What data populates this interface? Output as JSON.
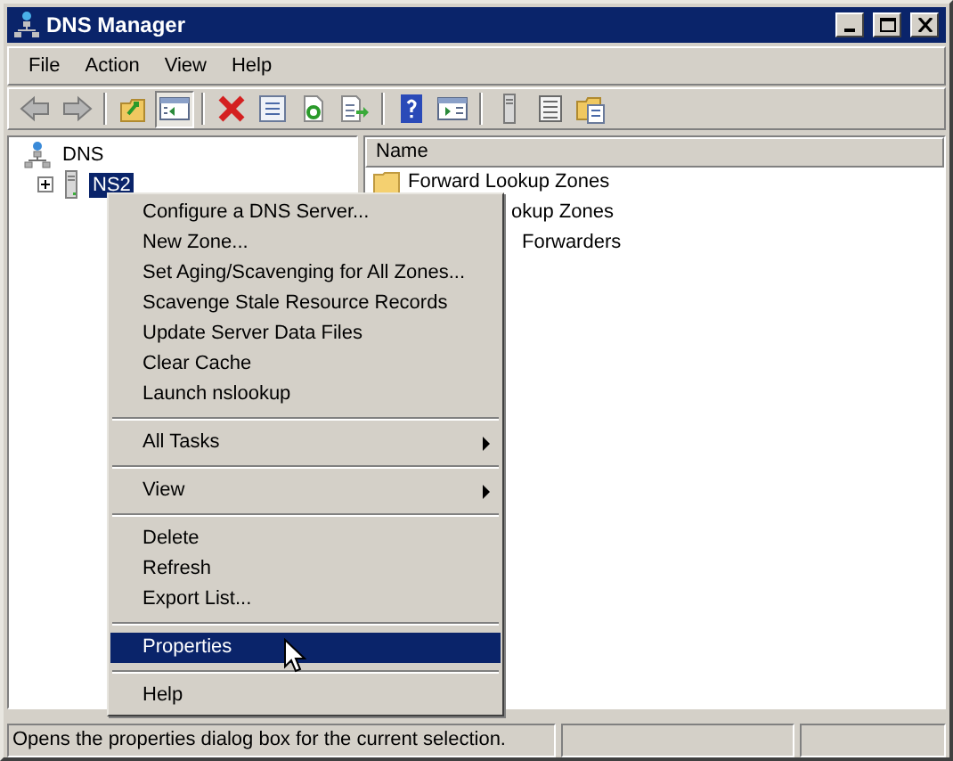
{
  "window": {
    "title": "DNS Manager"
  },
  "menu_bar": [
    "File",
    "Action",
    "View",
    "Help"
  ],
  "toolbar": [
    {
      "kind": "back",
      "pressed": false
    },
    {
      "kind": "forward",
      "pressed": false
    },
    {
      "kind": "sep"
    },
    {
      "kind": "up",
      "pressed": false
    },
    {
      "kind": "tree",
      "pressed": true
    },
    {
      "kind": "sep"
    },
    {
      "kind": "delete",
      "pressed": false
    },
    {
      "kind": "properties",
      "pressed": false
    },
    {
      "kind": "refresh",
      "pressed": false
    },
    {
      "kind": "export",
      "pressed": false
    },
    {
      "kind": "sep"
    },
    {
      "kind": "help",
      "pressed": false
    },
    {
      "kind": "action",
      "pressed": false
    },
    {
      "kind": "sep"
    },
    {
      "kind": "server",
      "pressed": false
    },
    {
      "kind": "list",
      "pressed": false
    },
    {
      "kind": "folders",
      "pressed": false
    }
  ],
  "tree": [
    {
      "label": "DNS",
      "kind": "root",
      "selected": false,
      "children": [
        {
          "label": "NS2",
          "kind": "server",
          "expanded": false,
          "selected": true
        }
      ]
    }
  ],
  "list": {
    "columns": [
      "Name"
    ],
    "rows": [
      {
        "label": "Forward Lookup Zones",
        "icon": true
      },
      {
        "label": "okup Zones",
        "icon": false
      },
      {
        "label": "Forwarders",
        "icon": false
      }
    ]
  },
  "context_menu": [
    {
      "kind": "item",
      "label": "Configure a DNS Server...",
      "selected": false
    },
    {
      "kind": "item",
      "label": "New Zone...",
      "selected": false
    },
    {
      "kind": "item",
      "label": "Set Aging/Scavenging for All Zones...",
      "selected": false
    },
    {
      "kind": "item",
      "label": "Scavenge Stale Resource Records",
      "selected": false
    },
    {
      "kind": "item",
      "label": "Update Server Data Files",
      "selected": false
    },
    {
      "kind": "item",
      "label": "Clear Cache",
      "selected": false
    },
    {
      "kind": "item",
      "label": "Launch nslookup",
      "selected": false
    },
    {
      "kind": "separator"
    },
    {
      "kind": "submenu",
      "label": "All Tasks",
      "selected": false
    },
    {
      "kind": "separator"
    },
    {
      "kind": "submenu",
      "label": "View",
      "selected": false
    },
    {
      "kind": "separator"
    },
    {
      "kind": "item",
      "label": "Delete",
      "selected": false
    },
    {
      "kind": "item",
      "label": "Refresh",
      "selected": false
    },
    {
      "kind": "item",
      "label": "Export List...",
      "selected": false
    },
    {
      "kind": "separator"
    },
    {
      "kind": "item",
      "label": "Properties",
      "selected": true
    },
    {
      "kind": "separator"
    },
    {
      "kind": "item",
      "label": "Help",
      "selected": false
    }
  ],
  "status_bar": [
    "Opens the properties dialog box for the current selection."
  ]
}
